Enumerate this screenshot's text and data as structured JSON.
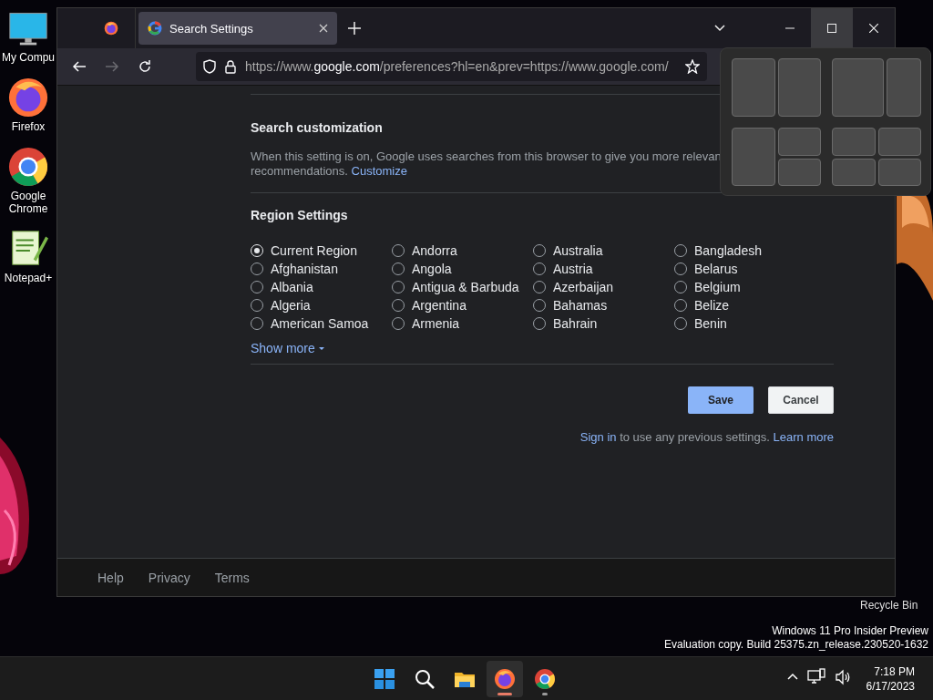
{
  "desktop": {
    "icons": [
      {
        "kind": "monitor",
        "label": "My Compu"
      },
      {
        "kind": "firefox",
        "label": "Firefox"
      },
      {
        "kind": "chrome",
        "label": "Google Chrome"
      },
      {
        "kind": "notepad",
        "label": "Notepad+"
      }
    ],
    "recycle_bin_label": "Recycle Bin",
    "watermark": [
      "Windows 11 Pro Insider Preview",
      "Evaluation copy. Build 25375.zn_release.230520-1632"
    ]
  },
  "browser": {
    "tabs": [
      {
        "kind": "pinned",
        "selected": false
      },
      {
        "kind": "page",
        "title": "Search Settings",
        "selected": true
      }
    ],
    "window_controls": [
      {
        "kind": "minimize",
        "hovered": false
      },
      {
        "kind": "maximize",
        "hovered": true
      },
      {
        "kind": "close",
        "hovered": false
      }
    ],
    "nav": [
      {
        "kind": "back",
        "disabled": false
      },
      {
        "kind": "forward",
        "disabled": true
      },
      {
        "kind": "reload",
        "disabled": false
      }
    ],
    "url": "https://www.**google.com**/preferences?hl=en&prev=https://www.google.com/",
    "page": {
      "customization": {
        "heading": "Search customization",
        "line_1": "When this setting is on, Google uses searches from this browser to give you more relevan",
        "line_2": "recommendations.",
        "link": "Customize"
      },
      "region": {
        "heading": "Region Settings",
        "options": [
          {
            "label": "Current Region",
            "selected": true
          },
          {
            "label": "Afghanistan",
            "selected": false
          },
          {
            "label": "Albania",
            "selected": false
          },
          {
            "label": "Algeria",
            "selected": false
          },
          {
            "label": "American Samoa",
            "selected": false
          },
          {
            "label": "Andorra",
            "selected": false
          },
          {
            "label": "Angola",
            "selected": false
          },
          {
            "label": "Antigua & Barbuda",
            "selected": false
          },
          {
            "label": "Argentina",
            "selected": false
          },
          {
            "label": "Armenia",
            "selected": false
          },
          {
            "label": "Australia",
            "selected": false
          },
          {
            "label": "Austria",
            "selected": false
          },
          {
            "label": "Azerbaijan",
            "selected": false
          },
          {
            "label": "Bahamas",
            "selected": false
          },
          {
            "label": "Bahrain",
            "selected": false
          },
          {
            "label": "Bangladesh",
            "selected": false
          },
          {
            "label": "Belarus",
            "selected": false
          },
          {
            "label": "Belgium",
            "selected": false
          },
          {
            "label": "Belize",
            "selected": false
          },
          {
            "label": "Benin",
            "selected": false
          }
        ],
        "show_more": "Show more"
      },
      "buttons": [
        {
          "kind": "primary",
          "label": "Save"
        },
        {
          "kind": "secondary",
          "label": "Cancel"
        }
      ],
      "sign_in": {
        "link_1": "Sign in",
        "text": "to use any previous settings.",
        "link_2": "Learn more"
      },
      "footer": [
        "Help",
        "Privacy",
        "Terms"
      ]
    },
    "snap_layouts": [
      {
        "kind": "halves"
      },
      {
        "kind": "wide-narrow"
      },
      {
        "kind": "main-stack"
      },
      {
        "kind": "quad"
      }
    ]
  },
  "taskbar": {
    "apps": [
      {
        "kind": "start",
        "selected": false,
        "running": false
      },
      {
        "kind": "search",
        "selected": false,
        "running": false
      },
      {
        "kind": "explorer",
        "selected": false,
        "running": false
      },
      {
        "kind": "firefox",
        "selected": true,
        "running": true
      },
      {
        "kind": "chrome",
        "selected": false,
        "running": true
      }
    ],
    "tray": [
      {
        "kind": "chevron"
      },
      {
        "kind": "network"
      },
      {
        "kind": "volume"
      }
    ],
    "time": "7:18 PM",
    "date": "6/17/2023"
  }
}
